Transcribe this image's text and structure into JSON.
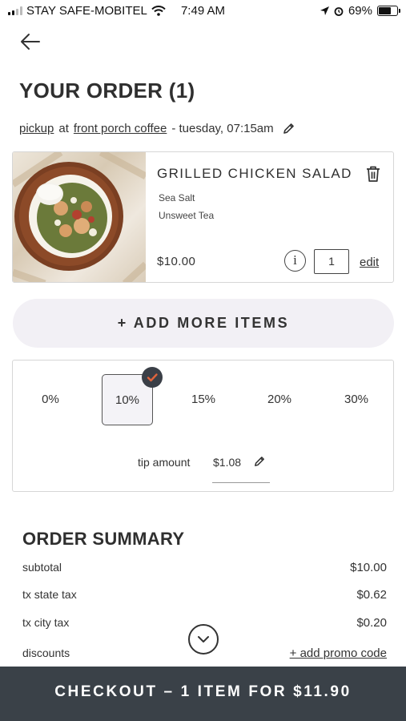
{
  "status_bar": {
    "carrier": "STAY SAFE-MOBITEL",
    "time": "7:49 AM",
    "battery": "69%",
    "battery_level": 0.69
  },
  "header": {
    "back_icon": "arrow-left-icon",
    "title": "YOUR ORDER (1)"
  },
  "pickup": {
    "mode": "pickup",
    "at": "at",
    "location": "front porch coffee",
    "when": "- tuesday, 07:15am",
    "edit_icon": "pencil-icon"
  },
  "cart": {
    "items": [
      {
        "name": "GRILLED CHICKEN SALAD",
        "modifiers": [
          "Sea Salt",
          "Unsweet Tea"
        ],
        "price": "$10.00",
        "quantity": "1",
        "edit_label": "edit",
        "info_icon": "info-icon",
        "delete_icon": "trash-icon"
      }
    ],
    "add_more_label": "+ ADD MORE ITEMS"
  },
  "tip": {
    "options": [
      "0%",
      "10%",
      "15%",
      "20%",
      "30%"
    ],
    "selected": "10%",
    "amount_label": "tip amount",
    "amount_value": "$1.08"
  },
  "summary": {
    "title": "ORDER SUMMARY",
    "rows": [
      {
        "label": "subtotal",
        "value": "$10.00"
      },
      {
        "label": "tx state tax",
        "value": "$0.62"
      },
      {
        "label": "tx city tax",
        "value": "$0.20"
      },
      {
        "label": "discounts",
        "value": "+ add promo code"
      }
    ]
  },
  "checkout": {
    "label": "CHECKOUT – 1 ITEM FOR $11.90"
  },
  "colors": {
    "checkout_bg": "#3a4148",
    "accent_check": "#e0643c",
    "add_more_bg": "#f2f0f5"
  }
}
